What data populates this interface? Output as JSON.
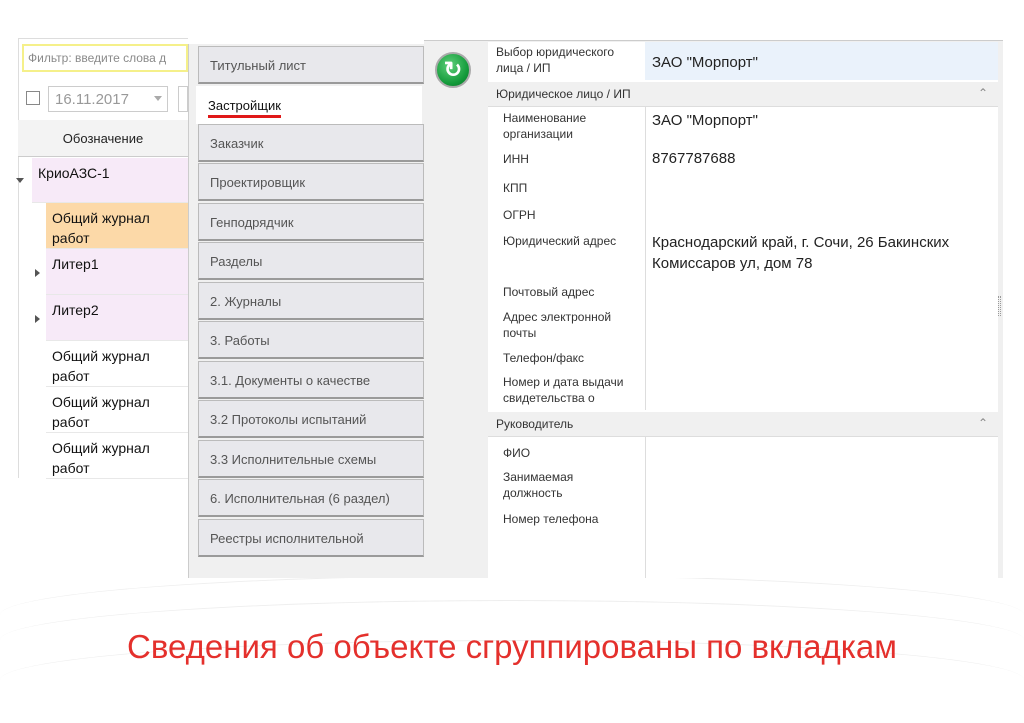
{
  "left_panel": {
    "filter_placeholder": "Фильтр: введите слова д",
    "date": "16.11.2017",
    "column_header": "Обозначение",
    "tree": [
      "КриоАЗС-1",
      "Общий журнал работ",
      "Литер1",
      "Литер2",
      "Общий журнал работ",
      "Общий журнал работ",
      "Общий журнал работ"
    ]
  },
  "tabs": [
    "Титульный лист",
    "Застройщик",
    "Заказчик",
    "Проектировщик",
    "Генподрядчик",
    "Разделы",
    "2. Журналы",
    "3. Работы",
    "3.1. Документы о качестве",
    "3.2 Протоколы испытаний",
    "3.3 Исполнительные схемы",
    "6. Исполнительная (6 раздел)",
    "Реестры исполнительной"
  ],
  "selected_tab": "Застройщик",
  "properties": {
    "select_label": "Выбор юридического лица / ИП",
    "select_value": "ЗАО \"Морпорт\"",
    "group1": "Юридическое лицо / ИП",
    "fields": [
      {
        "label": "Наименование организации",
        "value": "ЗАО \"Морпорт\""
      },
      {
        "label": "ИНН",
        "value": "8767787688"
      },
      {
        "label": "КПП",
        "value": ""
      },
      {
        "label": "ОГРН",
        "value": ""
      },
      {
        "label": "Юридический адрес",
        "value": "Краснодарский край, г. Сочи, 26 Бакинских Комиссаров ул, дом 78"
      },
      {
        "label": "Почтовый адрес",
        "value": ""
      },
      {
        "label": "Адрес электронной почты",
        "value": ""
      },
      {
        "label": "Телефон/факс",
        "value": ""
      },
      {
        "label": "Номер и дата выдачи свидетельства о",
        "value": ""
      }
    ],
    "group2": "Руководитель",
    "fields2": [
      {
        "label": "ФИО"
      },
      {
        "label": "Занимаемая должность"
      },
      {
        "label": "Номер телефона"
      }
    ]
  },
  "caption": "Сведения об объекте сгруппированы по вкладкам",
  "colors": {
    "caption": "#e4302c",
    "selected_row": "#fcd9a8",
    "tree_row": "#f7eaf8"
  }
}
